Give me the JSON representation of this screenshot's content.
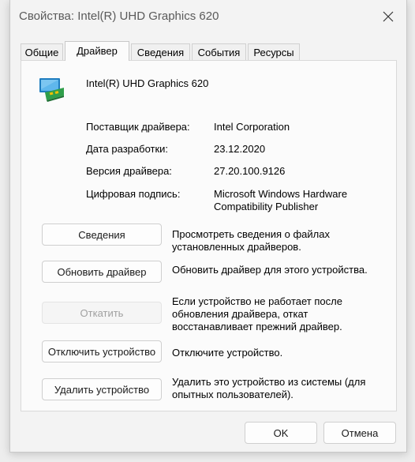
{
  "window": {
    "title": "Свойства: Intel(R) UHD Graphics 620"
  },
  "tabs": [
    {
      "label": "Общие"
    },
    {
      "label": "Драйвер"
    },
    {
      "label": "Сведения"
    },
    {
      "label": "События"
    },
    {
      "label": "Ресурсы"
    }
  ],
  "active_tab": "Драйвер",
  "device": {
    "name": "Intel(R) UHD Graphics 620",
    "icon": "display-adapter-icon"
  },
  "properties": [
    {
      "label": "Поставщик драйвера:",
      "value": "Intel Corporation"
    },
    {
      "label": "Дата разработки:",
      "value": "23.12.2020"
    },
    {
      "label": "Версия драйвера:",
      "value": "27.20.100.9126"
    },
    {
      "label": "Цифровая подпись:",
      "value_line1": "Microsoft Windows Hardware",
      "value_line2": "Compatibility Publisher"
    }
  ],
  "actions": [
    {
      "button": "Сведения",
      "desc_line1": "Просмотреть сведения о файлах",
      "desc_line2": "установленных драйверов."
    },
    {
      "button": "Обновить драйвер",
      "desc_line1": "Обновить драйвер для этого устройства."
    },
    {
      "button": "Откатить",
      "disabled": true,
      "desc_line1": "Если устройство не работает после",
      "desc_line2": "обновления драйвера, откат",
      "desc_line3": "восстанавливает прежний драйвер."
    },
    {
      "button": "Отключить устройство",
      "desc_line1": "Отключите устройство."
    },
    {
      "button": "Удалить устройство",
      "desc_line1": "Удалить это устройство из системы (для",
      "desc_line2": "опытных пользователей)."
    }
  ],
  "footer": {
    "ok_label": "OK",
    "cancel_label": "Отмена"
  },
  "colors": {
    "window_bg": "#f3f3f3",
    "panel_bg": "#fbfbfb",
    "disabled_text": "#a0a0a0"
  }
}
